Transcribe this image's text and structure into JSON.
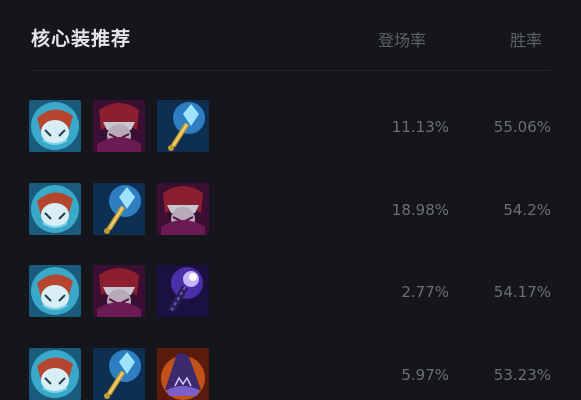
{
  "title": "核心装推荐",
  "columns": {
    "pick_rate": "登场率",
    "win_rate": "胜率"
  },
  "builds": [
    {
      "items": [
        "luden-companion-icon",
        "hextech-rocketbelt-icon",
        "rylai-scepter-icon"
      ],
      "pick_rate": "11.13%",
      "win_rate": "55.06%"
    },
    {
      "items": [
        "luden-companion-icon",
        "rylai-scepter-icon",
        "hextech-rocketbelt-icon"
      ],
      "pick_rate": "18.98%",
      "win_rate": "54.2%"
    },
    {
      "items": [
        "luden-companion-icon",
        "hextech-rocketbelt-icon",
        "void-staff-icon"
      ],
      "pick_rate": "2.77%",
      "win_rate": "54.17%"
    },
    {
      "items": [
        "luden-companion-icon",
        "rylai-scepter-icon",
        "rabadon-deathcap-icon"
      ],
      "pick_rate": "5.97%",
      "win_rate": "53.23%"
    }
  ]
}
